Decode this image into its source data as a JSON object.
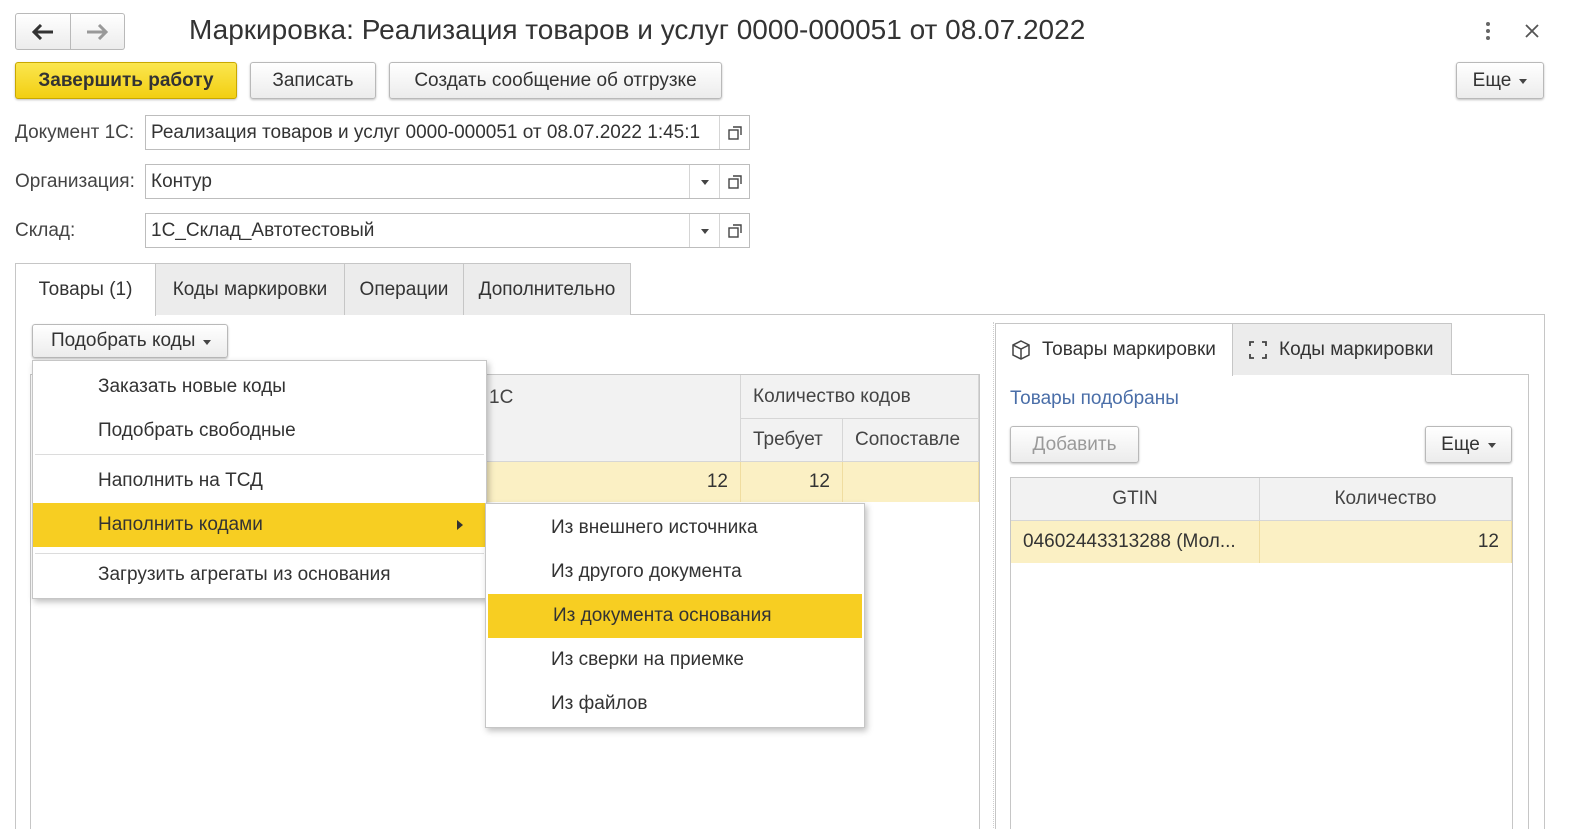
{
  "window": {
    "title": "Маркировка: Реализация товаров и услуг 0000-000051 от 08.07.2022"
  },
  "toolbar": {
    "finish_label": "Завершить работу",
    "save_label": "Записать",
    "create_msg_label": "Создать сообщение об отгрузке",
    "more_label": "Еще"
  },
  "form": {
    "doc_label": "Документ 1С:",
    "doc_value": "Реализация товаров и услуг 0000-000051 от 08.07.2022 1:45:1",
    "org_label": "Организация:",
    "org_value": "Контур",
    "warehouse_label": "Склад:",
    "warehouse_value": "1С_Склад_Автотестовый"
  },
  "tabs": [
    "Товары (1)",
    "Коды маркировки",
    "Операции",
    "Дополнительно"
  ],
  "pick_codes_label": "Подобрать коды",
  "grid": {
    "col_1c": "1С",
    "col_codes": "Количество кодов",
    "col_required": "Требует",
    "col_matched": "Сопоставле",
    "row": {
      "qty": "12",
      "required": "12",
      "matched": ""
    }
  },
  "right": {
    "tab_goods": "Товары маркировки",
    "tab_codes": "Коды маркировки",
    "status": "Товары подобраны",
    "add_label": "Добавить",
    "more_label": "Еще",
    "col_gtin": "GTIN",
    "col_qty": "Количество",
    "row": {
      "gtin": "04602443313288 (Мол...",
      "qty": "12"
    }
  },
  "menu": {
    "items": [
      "Заказать новые коды",
      "Подобрать свободные",
      "Наполнить на ТСД",
      "Наполнить кодами",
      "Загрузить агрегаты из основания"
    ]
  },
  "submenu": {
    "items": [
      "Из внешнего источника",
      "Из другого документа",
      "Из документа основания",
      "Из сверки на приемке",
      "Из файлов"
    ]
  },
  "colors": {
    "accent": "#f7ce22",
    "row_highlight": "#fbf0c4",
    "link": "#4a6ea8"
  }
}
